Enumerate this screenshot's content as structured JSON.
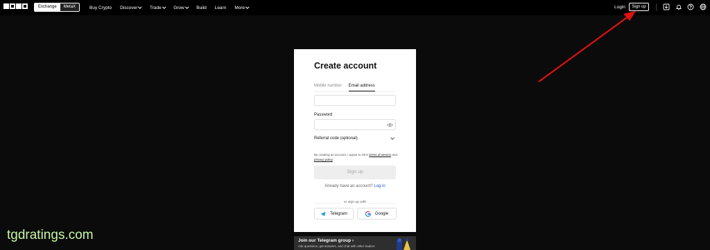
{
  "header": {
    "segment": [
      "Exchange",
      "MetaX"
    ],
    "nav": [
      {
        "label": "Buy Crypto",
        "chevron": false
      },
      {
        "label": "Discover",
        "chevron": true
      },
      {
        "label": "Trade",
        "chevron": true
      },
      {
        "label": "Grow",
        "chevron": true
      },
      {
        "label": "Build",
        "chevron": false
      },
      {
        "label": "Learn",
        "chevron": false
      },
      {
        "label": "More",
        "chevron": true
      }
    ],
    "login": "Login",
    "signup": "Sign up"
  },
  "form": {
    "title": "Create account",
    "tabs": [
      "Mobile number",
      "Email address"
    ],
    "password_label": "Password",
    "referral_label": "Referral code (optional)",
    "terms_prefix": "By creating an account, I agree to OKX ",
    "terms_link": "terms of service",
    "terms_and": " and ",
    "privacy_link": "privacy policy",
    "terms_end": ".",
    "submit": "Sign up",
    "have_account": "Already have an account?",
    "login_link": "Log in",
    "or_sign_up": "or sign up with",
    "telegram": "Telegram",
    "google": "Google"
  },
  "banner": {
    "title": "Join our Telegram group ›",
    "subtitle": "Ask questions, get answers, and chat with other traders"
  },
  "watermark": "tgdratings.com",
  "colors": {
    "background": "#0b0b0b",
    "card": "#ffffff",
    "link": "#1a55d8",
    "arrow": "#e01010"
  }
}
